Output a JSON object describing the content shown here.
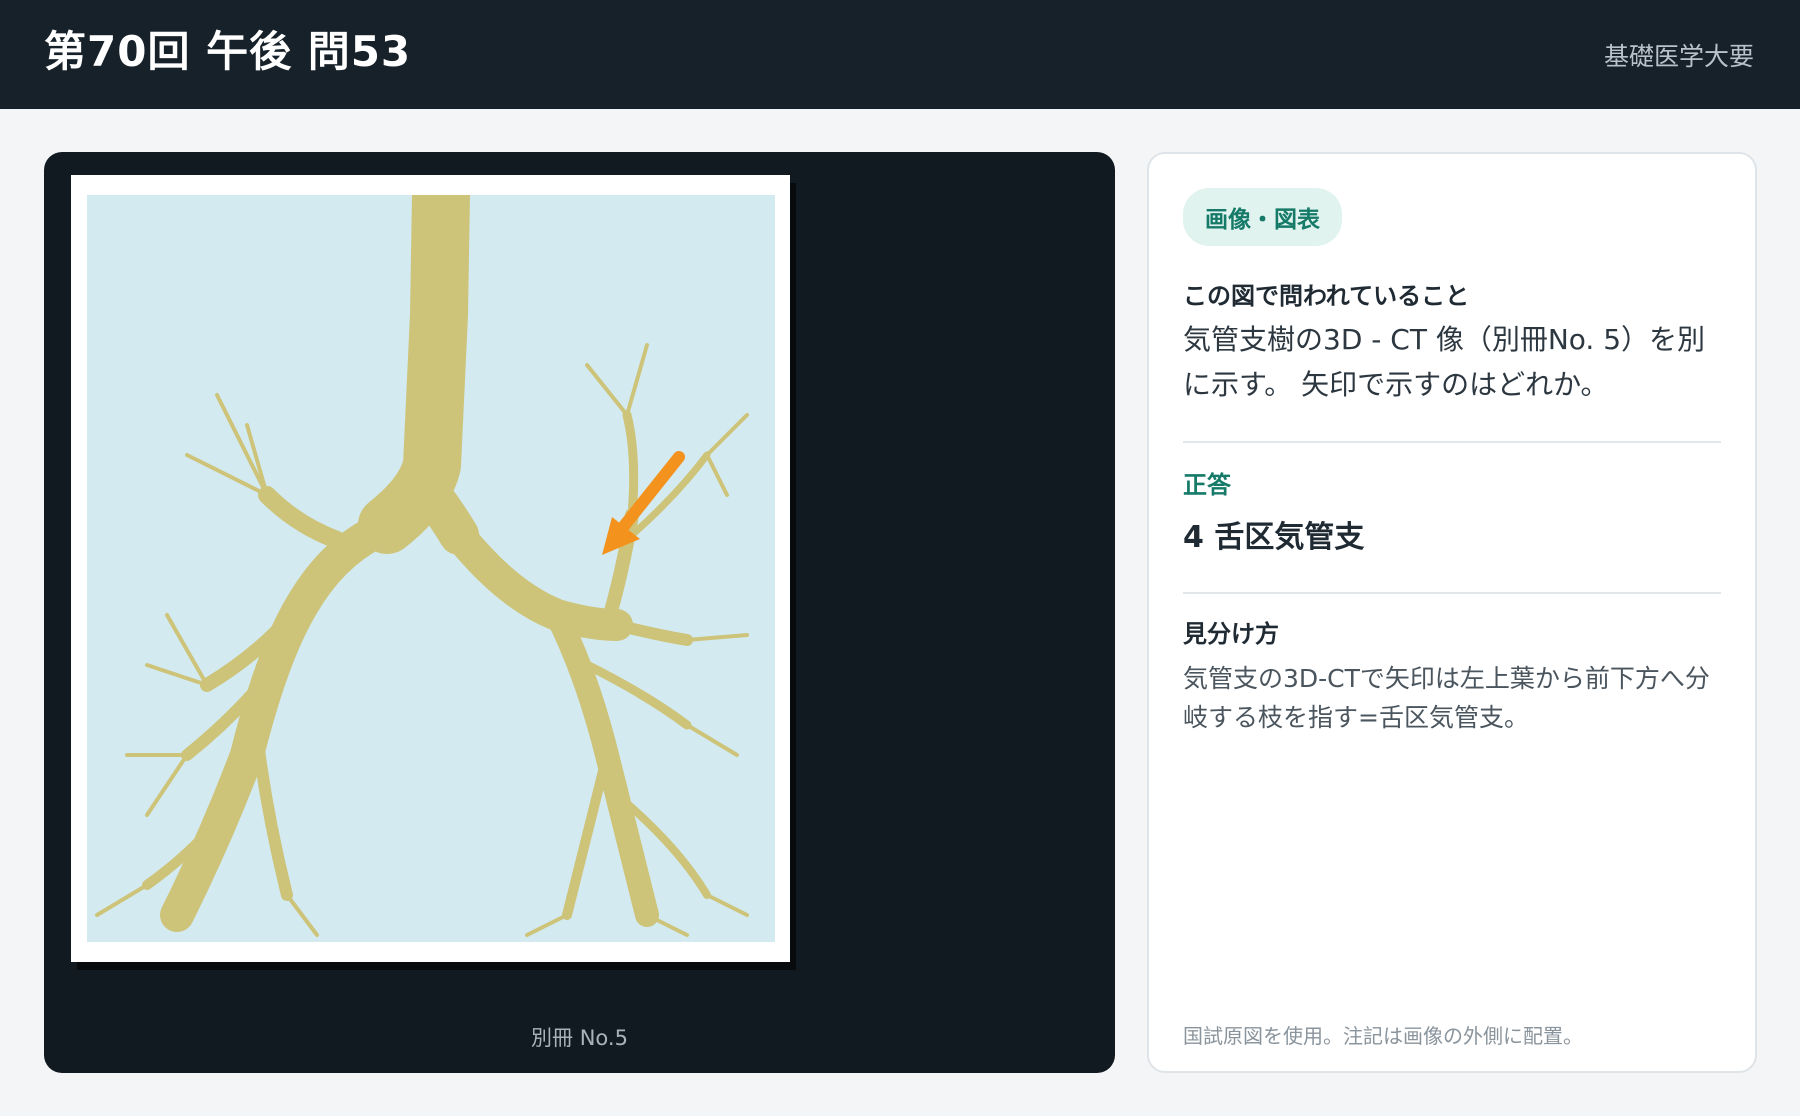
{
  "header": {
    "title": "第70回 午後 問53",
    "category": "基礎医学大要"
  },
  "viewer": {
    "caption": "別冊 No.5",
    "image_subject": "bronchial-tree-3d-ct",
    "colors": {
      "background": "#d3eaf0",
      "airway": "#cdc47a",
      "arrow": "#f4921e"
    }
  },
  "panel": {
    "badge": "画像・図表",
    "question_label": "この図で問われていること",
    "question_text": "気管支樹の3D - CT 像（別冊No. 5）を別に示す。 矢印で示すのはどれか。",
    "answer_label": "正答",
    "answer_text": "4 舌区気管支",
    "hint_label": "見分け方",
    "hint_text": "気管支の3D-CTで矢印は左上葉から前下方へ分岐する枝を指す=舌区気管支。",
    "footnote": "国試原図を使用。注記は画像の外側に配置。"
  },
  "colors": {
    "header_bg": "#17212a",
    "viewer_bg": "#121a21",
    "accent": "#157a68",
    "badge_bg": "#e0f3ee"
  }
}
